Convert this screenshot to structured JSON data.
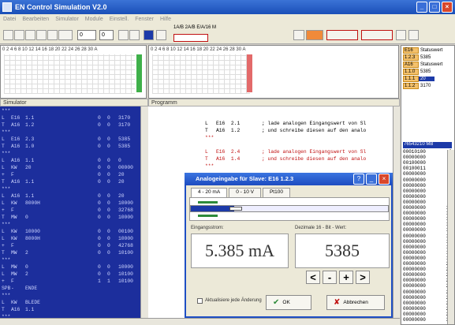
{
  "window": {
    "title": "EN Control Simulation V2.0"
  },
  "menu": [
    "Datei",
    "Bearbeiten",
    "Simulator",
    "Module",
    "Einstell.",
    "Fenster",
    "Hilfe"
  ],
  "toolbar": {
    "field1": "0",
    "field2": "0",
    "kbox": "1A/B 2A/B E/A/16 M"
  },
  "panels": {
    "simulator_title": "Simulator",
    "program_title": "Programm",
    "ruler": "0 2 4 6 8 10 12 14 16 18 20 22 24 26 28 30 A"
  },
  "statusbox": [
    {
      "k": "E16",
      "v": "Statuswert",
      "hl": false
    },
    {
      "k": "1.2.3",
      "v": "5385",
      "hl": false
    },
    {
      "k": "A16",
      "v": "Statuswert",
      "hl": false
    },
    {
      "k": "1.1.0",
      "v": "5385",
      "hl": false
    },
    {
      "k": "1.1.1",
      "v": "20",
      "hl": true
    },
    {
      "k": "1.1.2",
      "v": "3170",
      "hl": false
    }
  ],
  "mb": {
    "header": "76543210 MB",
    "rows": [
      [
        "00010100",
        "0"
      ],
      [
        "00000000",
        "1"
      ],
      [
        "00100000",
        "2"
      ],
      [
        "00100011",
        "3"
      ],
      [
        "00000000",
        "4"
      ],
      [
        "00000000",
        "5"
      ],
      [
        "00000000",
        "6"
      ],
      [
        "00000000",
        "7"
      ],
      [
        "00000000",
        "8"
      ],
      [
        "00000000",
        "9"
      ],
      [
        "00000000",
        "10"
      ],
      [
        "00000000",
        "11"
      ],
      [
        "00000000",
        "12"
      ],
      [
        "00000000",
        "13"
      ],
      [
        "00000000",
        "14"
      ],
      [
        "00000000",
        "15"
      ],
      [
        "00000000",
        "16"
      ],
      [
        "00000000",
        "17"
      ],
      [
        "00000000",
        "18"
      ],
      [
        "00000000",
        "19"
      ],
      [
        "00000000",
        "20"
      ],
      [
        "00000000",
        "21"
      ],
      [
        "00000000",
        "22"
      ],
      [
        "00000000",
        "23"
      ],
      [
        "00000000",
        "24"
      ],
      [
        "00000000",
        "25"
      ],
      [
        "00000000",
        "26"
      ],
      [
        "00000000",
        "27"
      ],
      [
        "00000000",
        "28"
      ],
      [
        "00000000",
        "29"
      ],
      [
        "00000000",
        "30"
      ]
    ]
  },
  "sim_rows": [
    [
      "***",
      "",
      "",
      "",
      "",
      ""
    ],
    [
      "L",
      "E16",
      "1.1",
      "0",
      "0",
      "3170"
    ],
    [
      "T",
      "A16",
      "1.2",
      "0",
      "0",
      "3170"
    ],
    [
      "***",
      "",
      "",
      "",
      "",
      ""
    ],
    [
      "L",
      "E16",
      "2.3",
      "0",
      "0",
      "5385"
    ],
    [
      "T",
      "A16",
      "1.0",
      "0",
      "0",
      "5385"
    ],
    [
      "***",
      "",
      "",
      "",
      "",
      ""
    ],
    [
      "L",
      "A16",
      "1.1",
      "0",
      "0",
      "0"
    ],
    [
      "L",
      "KW",
      "20",
      "0",
      "0",
      "00000"
    ],
    [
      "+",
      "F",
      "",
      "0",
      "0",
      "20"
    ],
    [
      "T",
      "A16",
      "1.1",
      "0",
      "0",
      "20"
    ],
    [
      "***",
      "",
      "",
      "",
      "",
      ""
    ],
    [
      "L",
      "A16",
      "1.1",
      "0",
      "0",
      "20"
    ],
    [
      "L",
      "KW",
      "8000H",
      "0",
      "0",
      "10000"
    ],
    [
      "+",
      "F",
      "",
      "0",
      "0",
      "32768"
    ],
    [
      "T",
      "MW",
      "0",
      "0",
      "0",
      "10000"
    ],
    [
      "***",
      "",
      "",
      "",
      "",
      ""
    ],
    [
      "L",
      "KW",
      "10000",
      "0",
      "0",
      "00100"
    ],
    [
      "L",
      "KW",
      "8000H",
      "0",
      "0",
      "10000"
    ],
    [
      "+",
      "F",
      "",
      "0",
      "0",
      "42768"
    ],
    [
      "T",
      "MW",
      "2",
      "0",
      "0",
      "10100"
    ],
    [
      "***",
      "",
      "",
      "",
      "",
      ""
    ],
    [
      "L",
      "MW",
      "0",
      "0",
      "0",
      "10000"
    ],
    [
      "L",
      "MW",
      "2",
      "0",
      "0",
      "10100"
    ],
    [
      "+",
      "F",
      "",
      "1",
      "1",
      "10100"
    ],
    [
      "SPB",
      "-",
      "ENDE",
      "",
      "",
      ""
    ],
    [
      "***",
      "",
      "",
      "",
      "",
      ""
    ],
    [
      "L",
      "KW",
      "BLEDE",
      "",
      "",
      ""
    ],
    [
      "T",
      "A16",
      "1.1",
      "",
      "",
      ""
    ],
    [
      "***",
      "",
      "",
      "",
      "",
      ""
    ]
  ],
  "prog_lines": [
    {
      "op": "L",
      "arg": "E16  2.1",
      "cm": "; lade analogen Eingangswert von Sl",
      "red": false
    },
    {
      "op": "T",
      "arg": "A16  1.2",
      "cm": "; und schreibe diesen auf den analo",
      "red": false
    },
    {
      "op": "***",
      "arg": "",
      "cm": "",
      "red": true
    },
    {
      "op": "",
      "arg": "",
      "cm": "",
      "red": false
    },
    {
      "op": "L",
      "arg": "E16  2.4",
      "cm": "; lade analogen Eingangswert von Sl",
      "red": true
    },
    {
      "op": "T",
      "arg": "A16  1.4",
      "cm": "; und schreibe diesen auf den analo",
      "red": true
    },
    {
      "op": "***",
      "arg": "",
      "cm": "",
      "red": true
    }
  ],
  "dialog": {
    "title": "Analogeingabe für Slave: E16 1.2.3",
    "tabs": [
      "4 - 20 mA",
      "0 - 10 V",
      "Pt100"
    ],
    "left_label": "Eingangsstrom:",
    "right_label": "Dezimale 16 - Bit - Wert:",
    "value": "5.385 mA",
    "decimal": "5385",
    "nav": [
      "<",
      "-",
      "+",
      ">"
    ],
    "checkbox": "Aktualisiere jede Änderung",
    "ok": "OK",
    "cancel": "Abbrechen",
    "level": 0.085
  }
}
